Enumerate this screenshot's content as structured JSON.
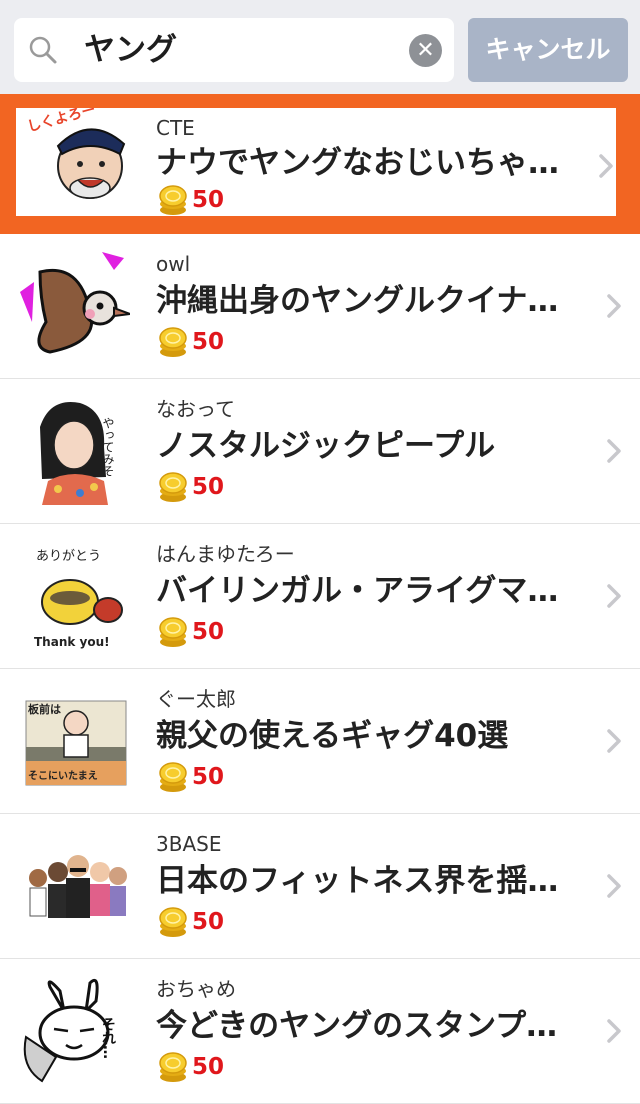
{
  "search": {
    "query": "ヤング",
    "cancel_label": "キャンセル"
  },
  "results": [
    {
      "author": "CTE",
      "title": "ナウでヤングなおじいちゃ…",
      "price": "50",
      "highlighted": true,
      "thumb_text": "しくよろー"
    },
    {
      "author": "owl",
      "title": "沖縄出身のヤングルクイナ…",
      "price": "50"
    },
    {
      "author": "なおって",
      "title": "ノスタルジックピープル",
      "price": "50",
      "thumb_text": "やってみそ"
    },
    {
      "author": "はんまゆたろー",
      "title": "バイリンガル・アライグマ…",
      "price": "50",
      "thumb_text": "ありがとう",
      "thumb_text2": "Thank you!"
    },
    {
      "author": "ぐー太郎",
      "title": "親父の使えるギャグ40選",
      "price": "50",
      "thumb_text": "板前は",
      "thumb_text2": "そこにいたまえ"
    },
    {
      "author": "3BASE",
      "title": "日本のフィットネス界を揺…",
      "price": "50"
    },
    {
      "author": "おちゃめ",
      "title": "今どきのヤングのスタンプ…",
      "price": "50",
      "thumb_text": "それ…"
    }
  ],
  "colors": {
    "highlight": "#f26522",
    "price": "#e0171c",
    "cancel_bg": "#a9b4c7"
  }
}
